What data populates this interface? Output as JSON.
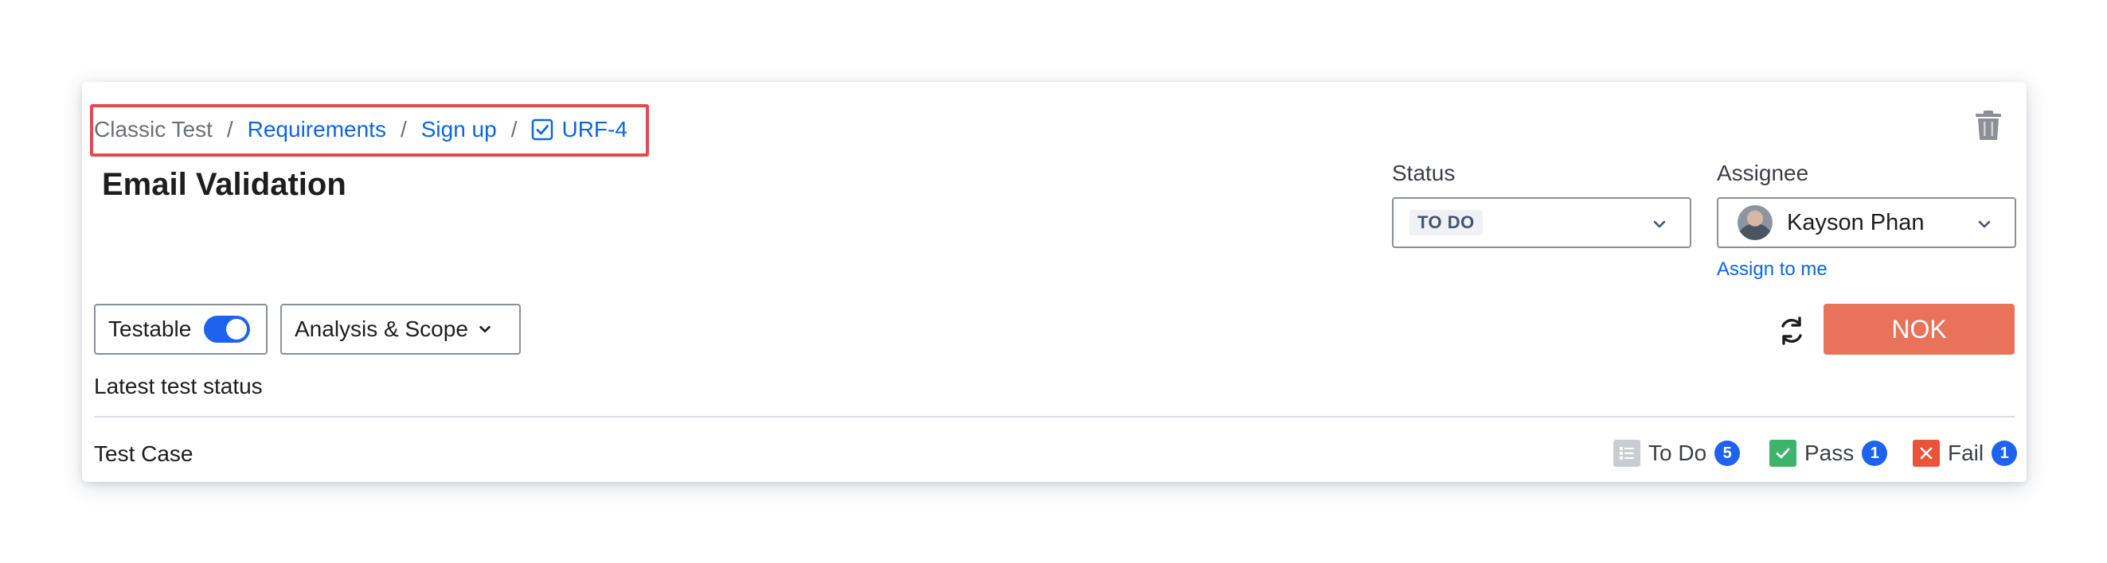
{
  "breadcrumb": {
    "project": "Classic Test",
    "separator": "/",
    "section": "Requirements",
    "parent": "Sign up",
    "issue_key": "URF-4"
  },
  "issue": {
    "title": "Email Validation"
  },
  "status": {
    "label": "Status",
    "value": "TO DO"
  },
  "assignee": {
    "label": "Assignee",
    "name": "Kayson Phan",
    "assign_to_me": "Assign to me"
  },
  "toolbar": {
    "testable_label": "Testable",
    "testable_on": true,
    "analysis_label": "Analysis & Scope",
    "nok_label": "NOK"
  },
  "test_status": {
    "heading": "Latest test status",
    "row_label": "Test Case",
    "counts": [
      {
        "label": "To Do",
        "count": "5"
      },
      {
        "label": "Pass",
        "count": "1"
      },
      {
        "label": "Fail",
        "count": "1"
      }
    ]
  },
  "colors": {
    "link": "#0c66e4",
    "nok": "#e9735a",
    "pass": "#3fb36b",
    "fail": "#e8533a",
    "badge": "#1d63ed",
    "highlight": "#e5484d"
  },
  "icons": [
    "check-square-icon",
    "trash-icon",
    "chevron-down-icon",
    "refresh-icon",
    "list-icon",
    "check-icon",
    "close-icon"
  ]
}
